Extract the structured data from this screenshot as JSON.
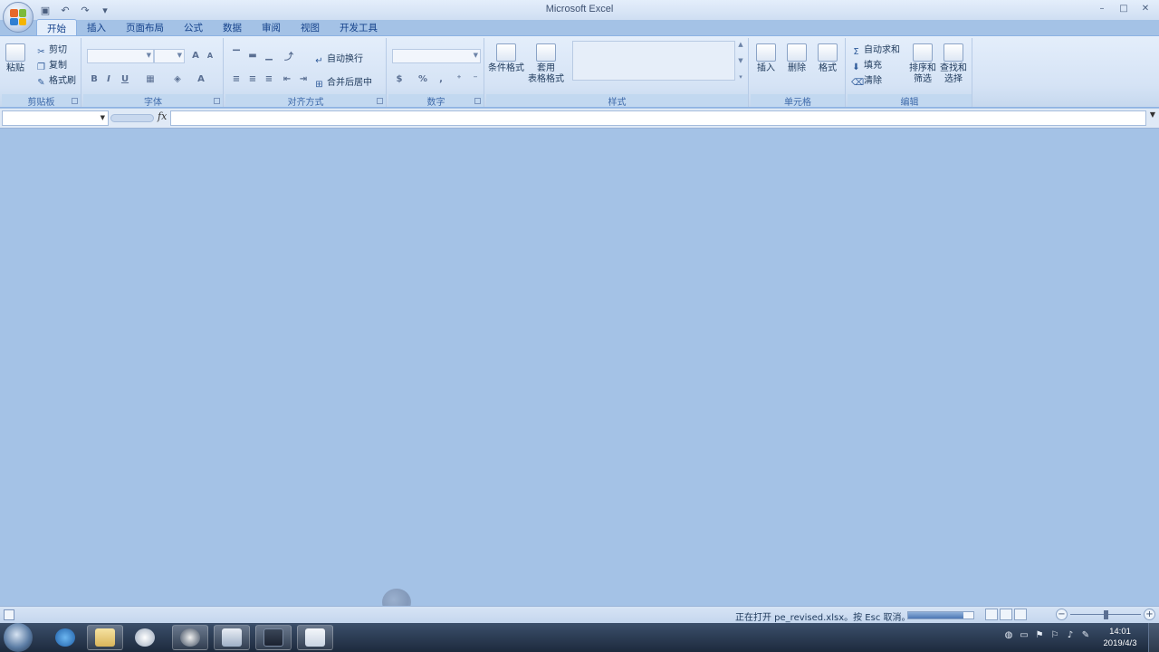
{
  "window": {
    "title": "Microsoft Excel",
    "minimize_glyph": "–",
    "maximize_glyph": "□",
    "close_glyph": "✕"
  },
  "quick_access": {
    "save_glyph": "▣",
    "undo_glyph": "↶",
    "redo_glyph": "↷",
    "customize_glyph": "▾"
  },
  "tabs": [
    "开始",
    "插入",
    "页面布局",
    "公式",
    "数据",
    "审阅",
    "视图",
    "开发工具"
  ],
  "active_tab": "开始",
  "ribbon": {
    "clipboard": {
      "label": "剪贴板",
      "paste": "粘贴",
      "cut": "剪切",
      "copy": "复制",
      "format_painter": "格式刷"
    },
    "font": {
      "label": "字体",
      "grow": "A",
      "shrink": "A",
      "bold": "B",
      "italic": "I",
      "underline": "U",
      "font_color": "A"
    },
    "alignment": {
      "label": "对齐方式",
      "wrap_text": "自动换行",
      "merge_center": "合并后居中"
    },
    "number": {
      "label": "数字",
      "percent": "%"
    },
    "styles": {
      "label": "样式",
      "conditional_format": "条件格式",
      "table_format_1": "套用",
      "table_format_2": "表格格式"
    },
    "cells": {
      "label": "单元格",
      "insert": "插入",
      "delete": "删除",
      "format": "格式"
    },
    "editing": {
      "label": "编辑",
      "autosum_symbol": "Σ",
      "autosum": "自动求和",
      "fill": "填充",
      "clear": "清除",
      "sort_filter_1": "排序和",
      "sort_filter_2": "筛选",
      "find_select_1": "查找和",
      "find_select_2": "选择"
    }
  },
  "formula_bar": {
    "fx_label": "fx",
    "expand_glyph": "¥"
  },
  "status_bar": {
    "message": "正在打开 pe_revised.xlsx。按 Esc 取消。",
    "progress_fraction": 0.85,
    "zoom_fraction": 0.5
  },
  "clock": {
    "time": "14:01",
    "date": "2019/4/3"
  },
  "colors": {
    "workspace": "#a4c2e6",
    "ribbon": "#dbe6f4",
    "taskbar": "#2a3a52"
  }
}
